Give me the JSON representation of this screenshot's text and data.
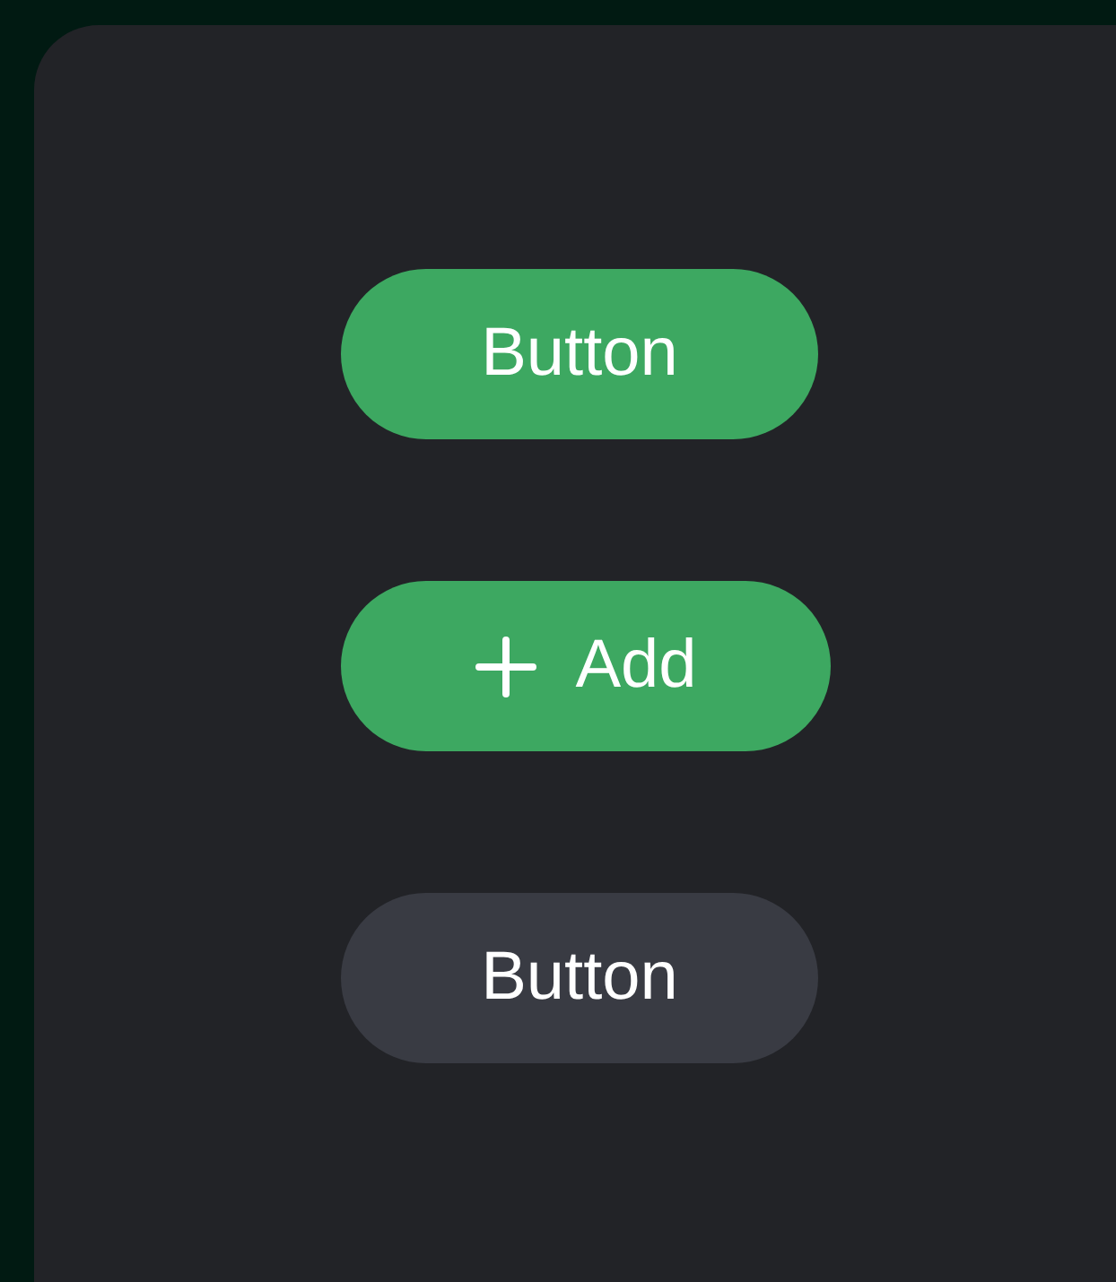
{
  "buttons": [
    {
      "label": "Button",
      "kind": "primary"
    },
    {
      "label": "Add",
      "kind": "primary-with-icon"
    },
    {
      "label": "Button",
      "kind": "secondary"
    }
  ]
}
